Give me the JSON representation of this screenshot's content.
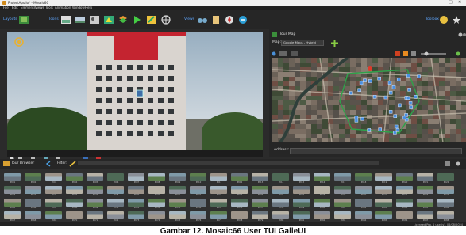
{
  "window": {
    "title": "ProjectApollo* - Mosaic66"
  },
  "menu": [
    "File",
    "Edit",
    "Elements",
    "Views",
    "Tools",
    "Animation",
    "Window",
    "Help"
  ],
  "toolbar": {
    "layouts_label": "Layouts",
    "icons_label": "Icons",
    "views_label": "Views",
    "toolbox_label": "Toolbox"
  },
  "tour_map": {
    "title": "Tour Map",
    "map_label": "Map:",
    "map_value": "Google Maps - Hybrid"
  },
  "address": {
    "label": "Address:"
  },
  "browser": {
    "title": "Tour Browser",
    "filter_label": "Filter:"
  },
  "thumb_rows": [
    [
      "P001",
      "P002",
      "P003",
      "P004",
      "P005",
      "P006",
      "P007",
      "P008",
      "P009",
      "P010",
      "P011",
      "P012",
      "P013",
      "P014",
      "P015",
      "P016",
      "P017",
      "P018",
      "P019",
      "P020",
      "P021",
      "P022"
    ],
    [
      "P023",
      "P024",
      "P025",
      "P026",
      "P027",
      "P028",
      "P029",
      "P030",
      "P031",
      "P032",
      "P033",
      "P034",
      "P035",
      "P036",
      "P037",
      "P038",
      "P039",
      "P040",
      "P041",
      "P042",
      "P043",
      "P044"
    ],
    [
      "P045",
      "P046",
      "P047",
      "P048",
      "P049",
      "P050",
      "P051",
      "P052",
      "P053",
      "P054",
      "P055",
      "P056",
      "P057",
      "P058",
      "P059",
      "P060",
      "P061",
      "P062",
      "P063",
      "P064",
      "P065",
      "P066"
    ],
    [
      "P067",
      "P068",
      "P069",
      "P070",
      "P071",
      "P072",
      "P073",
      "P074",
      "P075",
      "P076",
      "P077",
      "P078",
      "P079",
      "P080",
      "P081",
      "P082",
      "P083",
      "P084",
      "P085",
      "P086",
      "P087",
      "P088"
    ]
  ],
  "status": {
    "text": "Licensed Pro, 1 user(s), 06/08/2024"
  },
  "caption": "Gambar 12. Mosaic66 User TUI GalleUI"
}
